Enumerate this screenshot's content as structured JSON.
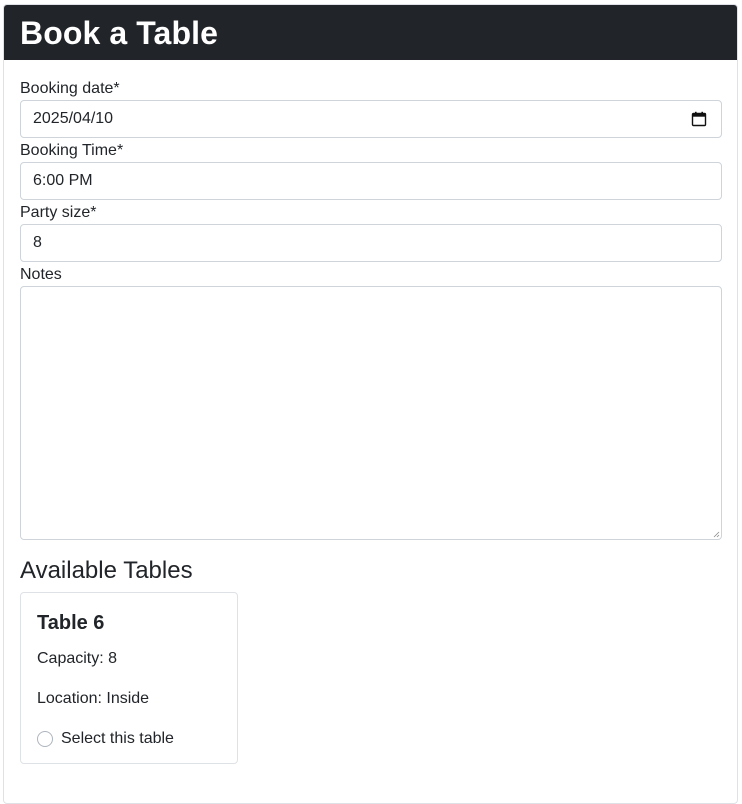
{
  "header": {
    "title": "Book a Table"
  },
  "form": {
    "date": {
      "label": "Booking date*",
      "value": "2025/04/10",
      "icon": "calendar-icon"
    },
    "time": {
      "label": "Booking Time*",
      "value": "6:00 PM"
    },
    "party": {
      "label": "Party size*",
      "value": "8"
    },
    "notes": {
      "label": "Notes",
      "value": ""
    }
  },
  "tables_section": {
    "title": "Available Tables",
    "tables": [
      {
        "name": "Table 6",
        "capacity": "Capacity: 8",
        "location": "Location: Inside",
        "select_label": "Select this table",
        "selected": false
      }
    ]
  },
  "colors": {
    "header_bg": "#212529",
    "header_text": "#ffffff",
    "border": "#ced4da"
  }
}
